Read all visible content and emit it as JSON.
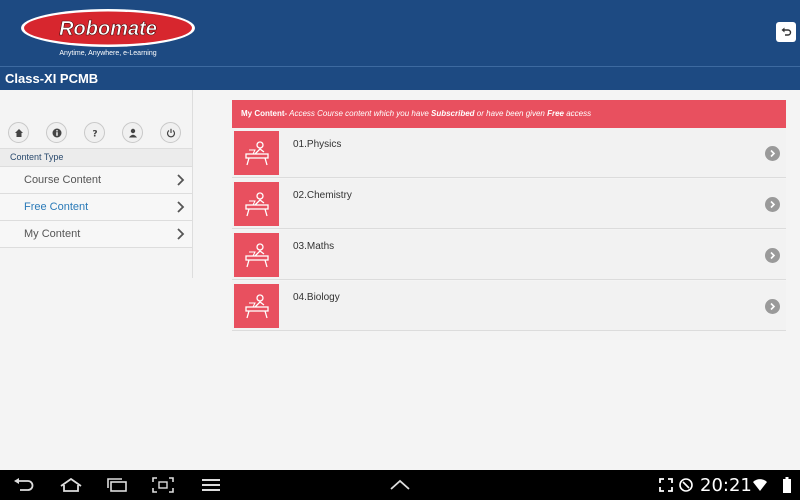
{
  "app": {
    "logo_text": "Robomate",
    "tagline": "Anytime, Anywhere, e-Learning"
  },
  "title_bar": {
    "title": "Class-XI PCMB"
  },
  "sidebar": {
    "icons": [
      "home-icon",
      "info-icon",
      "help-icon",
      "user-icon",
      "power-icon"
    ],
    "section_title": "Content Type",
    "items": [
      {
        "label": "Course Content",
        "active": false
      },
      {
        "label": "Free Content",
        "active": true
      },
      {
        "label": "My Content",
        "active": false
      }
    ]
  },
  "banner": {
    "title": "My Content-",
    "text_before": " Access Course content which you have ",
    "subscribed": "Subscribed",
    "text_middle": " or have been given ",
    "free": "Free",
    "text_after": " access"
  },
  "subjects": [
    {
      "label": "01.Physics"
    },
    {
      "label": "02.Chemistry"
    },
    {
      "label": "03.Maths"
    },
    {
      "label": "04.Biology"
    }
  ],
  "status_bar": {
    "time": "20:21"
  },
  "colors": {
    "header_blue": "#1d4a82",
    "accent_red": "#e8505f",
    "link_blue": "#2a7ab8"
  }
}
